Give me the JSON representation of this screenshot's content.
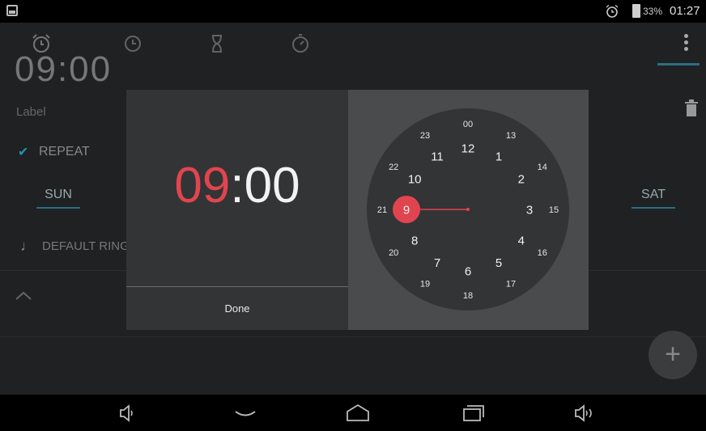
{
  "status_bar": {
    "battery_percent": "33%",
    "time": "01:27"
  },
  "tabs": [
    {
      "icon": "alarm-icon"
    },
    {
      "icon": "clock-icon"
    },
    {
      "icon": "timer-icon"
    },
    {
      "icon": "stopwatch-icon"
    }
  ],
  "alarm_item": {
    "time": "09:00",
    "label": "Label",
    "repeat": "REPEAT",
    "day_first": "SUN",
    "day_last": "SAT",
    "ringtone": "DEFAULT RINGTONE"
  },
  "time_picker": {
    "hour": "09",
    "separator": ":",
    "minute": "00",
    "done": "Done",
    "outer_hours": [
      "00",
      "13",
      "14",
      "15",
      "16",
      "17",
      "18",
      "19",
      "20",
      "21",
      "22",
      "23"
    ],
    "inner_hours": [
      "12",
      "1",
      "2",
      "3",
      "4",
      "5",
      "6",
      "7",
      "8",
      "9",
      "10",
      "11"
    ],
    "selected_hour": "9"
  },
  "colors": {
    "accent": "#e0454f",
    "highlight": "#2a6f83"
  }
}
